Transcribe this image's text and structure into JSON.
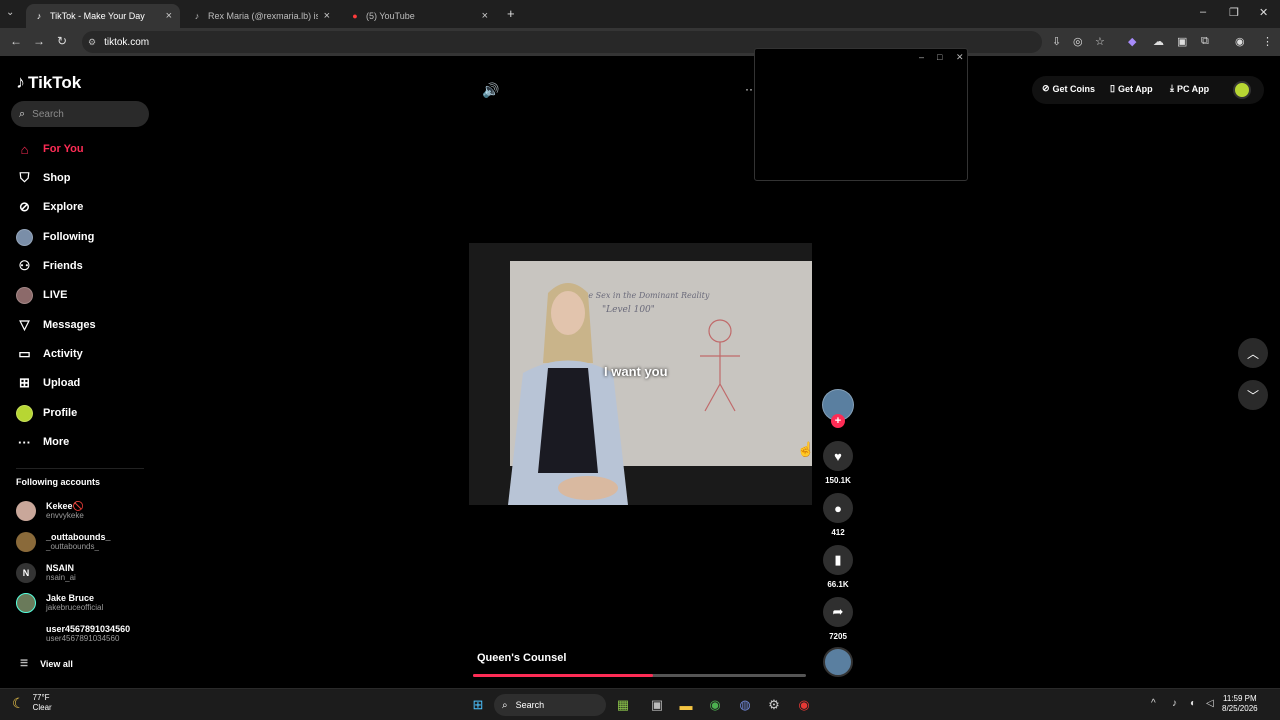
{
  "browser": {
    "tabs": [
      {
        "title": "TikTok - Make Your Day",
        "active": true,
        "icon": "tiktok-icon"
      },
      {
        "title": "Rex Maria (@rexmaria.lb) is LIVE",
        "active": false,
        "icon": "tiktok-icon"
      },
      {
        "title": "(5) YouTube",
        "active": false,
        "icon": "youtube-icon"
      }
    ],
    "url": "tiktok.com"
  },
  "sidebar": {
    "logo": "TikTok",
    "search_placeholder": "Search",
    "nav": [
      {
        "label": "For You",
        "icon": "home-icon",
        "active": true
      },
      {
        "label": "Shop",
        "icon": "shopping-bag-icon"
      },
      {
        "label": "Explore",
        "icon": "compass-icon"
      },
      {
        "label": "Following",
        "icon": "avatar"
      },
      {
        "label": "Friends",
        "icon": "friends-icon"
      },
      {
        "label": "LIVE",
        "icon": "avatar"
      },
      {
        "label": "Messages",
        "icon": "send-icon"
      },
      {
        "label": "Activity",
        "icon": "chat-icon"
      },
      {
        "label": "Upload",
        "icon": "plus-square-icon"
      },
      {
        "label": "Profile",
        "icon": "avatar"
      },
      {
        "label": "More",
        "icon": "more-icon"
      }
    ],
    "following_title": "Following accounts",
    "accounts": [
      {
        "name": "Kekee🚫",
        "handle": "envvykeke"
      },
      {
        "name": "_outtabounds_",
        "handle": "_outtabounds_"
      },
      {
        "name": "NSAIN",
        "handle": "nsain_ai",
        "initial": "N"
      },
      {
        "name": "Jake Bruce",
        "handle": "jakebruceofficial"
      },
      {
        "name": "user4567891034560",
        "handle": "user4567891034560"
      }
    ],
    "view_all": "View all"
  },
  "topbar": {
    "get_coins": "Get Coins",
    "get_app": "Get App",
    "pc_app": "PC App"
  },
  "video": {
    "caption": "I want you",
    "whiteboard_text": "the Sex in the Dominant Reality",
    "whiteboard_text2": "\"Level 100\"",
    "title": "Queen's Counsel",
    "progress": 0.54
  },
  "actions": {
    "likes": "150.1K",
    "comments": "412",
    "saves": "66.1K",
    "shares": "7205"
  },
  "taskbar": {
    "temp": "77°F",
    "weather": "Clear",
    "search": "Search",
    "time": "11:59 PM",
    "date": "8/25/2026"
  }
}
